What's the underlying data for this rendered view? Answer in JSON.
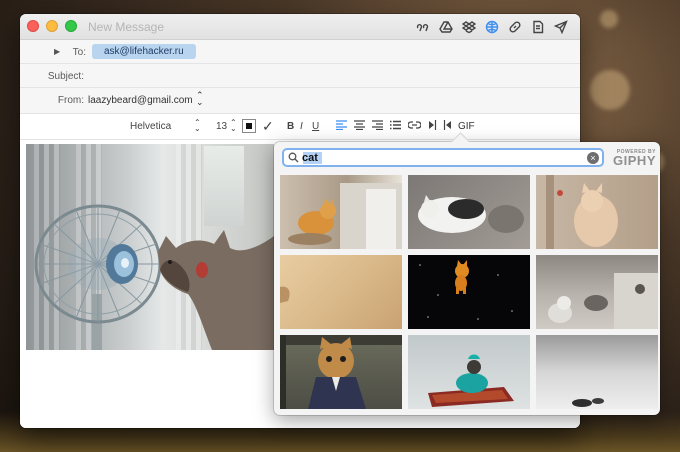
{
  "window": {
    "title": "New Message"
  },
  "headers": {
    "to_label": "To:",
    "to_recipient": "ask@lifehacker.ru",
    "subject_label": "Subject:",
    "subject_value": "",
    "from_label": "From:",
    "from_value": "laazybeard@gmail.com"
  },
  "format_bar": {
    "font_name": "Helvetica",
    "font_size": "13",
    "bold": "B",
    "italic": "I",
    "underline": "U",
    "gif_label": "GIF"
  },
  "giphy": {
    "search_value": "cat",
    "powered_small": "POWERED BY",
    "powered_brand": "GIPHY",
    "result_count_rows": 3,
    "result_count_cols": 3
  },
  "colors": {
    "accent": "#3c8ef0",
    "recipient_token": "#b9d4ee"
  },
  "toolbar_icons": [
    "quote-icon",
    "google-drive-icon",
    "dropbox-icon",
    "giphy-icon",
    "link-icon",
    "attachment-icon",
    "send-icon"
  ]
}
